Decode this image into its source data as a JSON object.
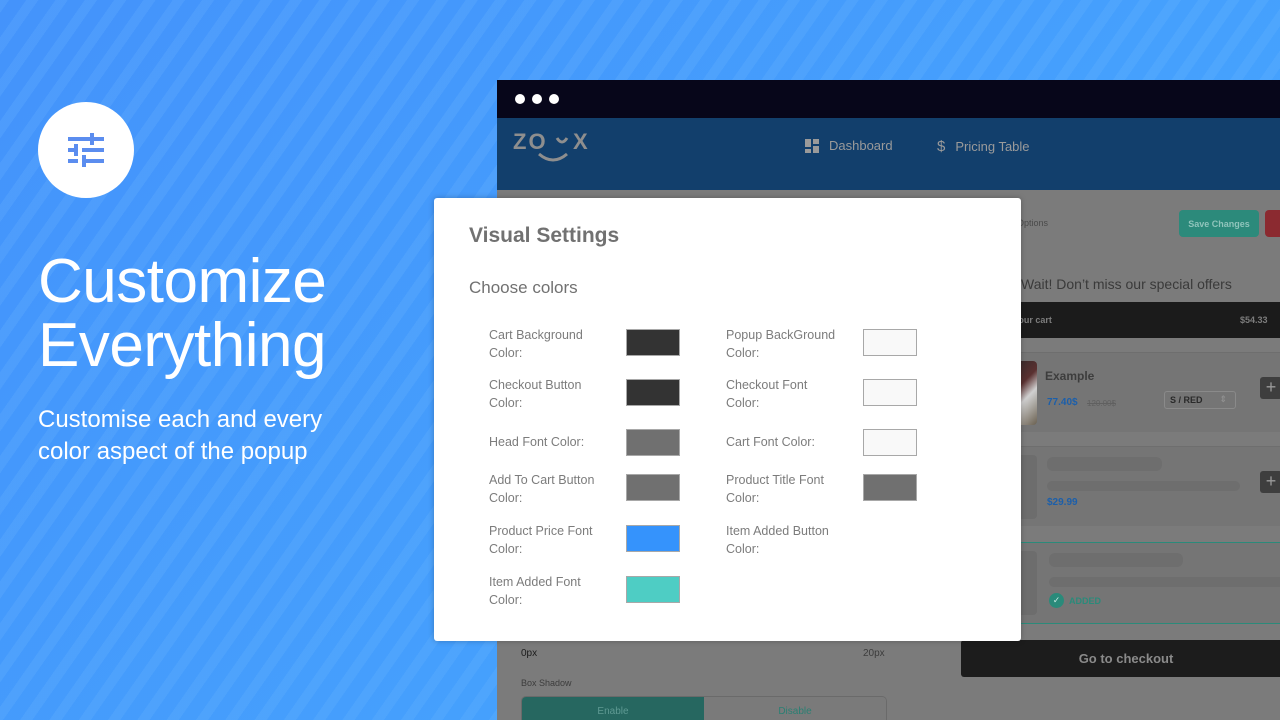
{
  "hero": {
    "icon": "sliders-icon",
    "title_line1": "Customize",
    "title_line2": "Everything",
    "subtitle": "Customise each and every color aspect of the popup"
  },
  "browser": {
    "logo_text": "ZOUX",
    "nav": [
      {
        "label": "Dashboard",
        "icon": "dashboard-grid-icon"
      },
      {
        "label": "Pricing Table",
        "icon": "dollar-icon"
      }
    ],
    "options_label": "Options",
    "save_label": "Save Changes",
    "preview": {
      "popup_title": "Wait! Don’t miss our special offers",
      "cart_label": "Your cart",
      "cart_total": "$54.33",
      "product": {
        "name": "Example",
        "price": "77.40$",
        "old_price": "120.00$",
        "variant": "S / RED"
      },
      "product2_price": "$29.99",
      "added_label": "ADDED",
      "checkout_label": "Go to checkout"
    },
    "settings": {
      "range_min": "0px",
      "range_max": "20px",
      "box_shadow_label": "Box Shadow",
      "enable_label": "Enable",
      "disable_label": "Disable"
    }
  },
  "modal": {
    "title": "Visual Settings",
    "subtitle": "Choose colors",
    "left_column": [
      {
        "label": "Cart Background Color:",
        "color": "#333333"
      },
      {
        "label": "Checkout Button Color:",
        "color": "#333333"
      },
      {
        "label": "Head Font Color:",
        "color": "#707070"
      },
      {
        "label": "Add To Cart Button Color:",
        "color": "#707070"
      },
      {
        "label": "Product Price Font Color:",
        "color": "#3593fc"
      },
      {
        "label": "Item Added Font Color:",
        "color": "#4ecdc4"
      }
    ],
    "right_column": [
      {
        "label": "Popup BackGround Color:",
        "color": "#f9f9f9"
      },
      {
        "label": "Checkout Font Color:",
        "color": "#f9f9f9"
      },
      {
        "label": "Cart Font Color:",
        "color": "#f9f9f9"
      },
      {
        "label": "Product Title Font Color:",
        "color": "#707070"
      },
      {
        "label": "Item Added Button Color:",
        "color": null
      }
    ]
  }
}
